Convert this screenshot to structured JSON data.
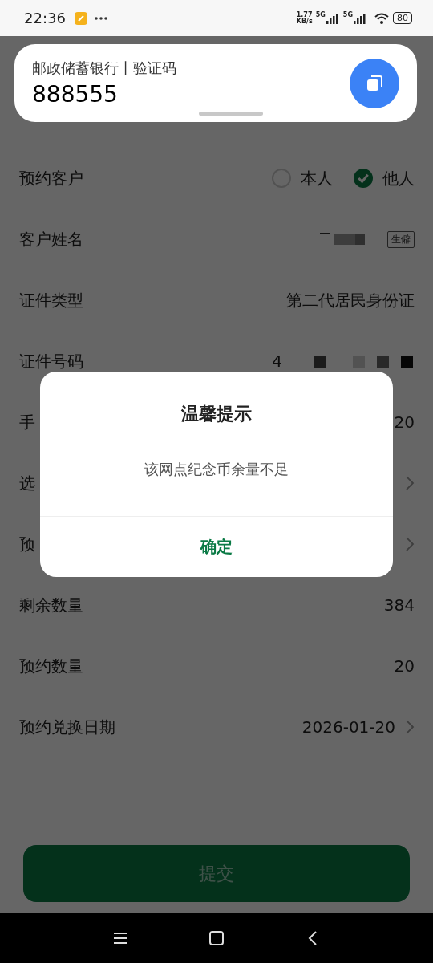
{
  "status_bar": {
    "time": "22:36",
    "speed": "1.77",
    "speed_unit": "KB/s",
    "network_1": "5G",
    "network_2": "5G",
    "battery": "80"
  },
  "notification": {
    "title": "邮政储蓄银行丨验证码",
    "code": "888555"
  },
  "rows": [
    {
      "kind": "radio",
      "label": "预约客户",
      "options": [
        {
          "label": "本人",
          "selected": false
        },
        {
          "label": "他人",
          "selected": true
        }
      ]
    },
    {
      "kind": "name",
      "label": "客户姓名",
      "badge": "生僻"
    },
    {
      "kind": "text",
      "label": "证件类型",
      "value": "第二代居民身份证"
    },
    {
      "kind": "id",
      "label": "证件号码",
      "value": "4"
    },
    {
      "kind": "text",
      "label": "手",
      "value": "20"
    },
    {
      "kind": "link",
      "label": "选"
    },
    {
      "kind": "link",
      "label": "预"
    },
    {
      "kind": "text",
      "label": "剩余数量",
      "value": "384"
    },
    {
      "kind": "text",
      "label": "预约数量",
      "value": "20"
    },
    {
      "kind": "link",
      "label": "预约兑换日期",
      "value": "2026-01-20"
    }
  ],
  "submit": {
    "label": "提交"
  },
  "dialog": {
    "title": "温馨提示",
    "message": "该网点纪念币余量不足",
    "confirm": "确定"
  }
}
